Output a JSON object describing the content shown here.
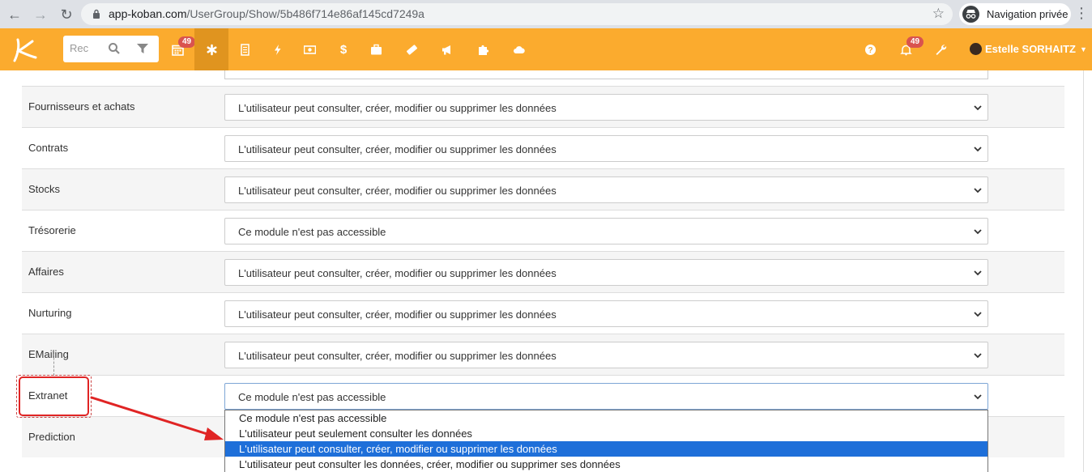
{
  "browser": {
    "url_host": "app-koban.com",
    "url_path": "/UserGroup/Show/5b486f714e86af145cd7249a",
    "incognito_label": "Navigation privée"
  },
  "header": {
    "search_placeholder": "Rec",
    "calendar_badge": "49",
    "notification_badge": "49",
    "user_name": "Estelle SORHAITZ",
    "accent_color": "#fbab2e",
    "active_color": "#e0941f",
    "badge_color": "#d9534f",
    "icons": [
      "calendar-icon",
      "asterisk-icon",
      "document-icon",
      "bolt-icon",
      "money-icon",
      "dollar-icon",
      "briefcase-icon",
      "ticket-icon",
      "megaphone-icon",
      "puzzle-icon",
      "cloud-icon",
      "help-icon",
      "bell-icon",
      "wrench-icon"
    ]
  },
  "rows": [
    {
      "label": "Fournisseurs et achats",
      "value": "L'utilisateur peut consulter, créer, modifier ou supprimer les données"
    },
    {
      "label": "Contrats",
      "value": "L'utilisateur peut consulter, créer, modifier ou supprimer les données"
    },
    {
      "label": "Stocks",
      "value": "L'utilisateur peut consulter, créer, modifier ou supprimer les données"
    },
    {
      "label": "Trésorerie",
      "value": "Ce module n'est pas accessible"
    },
    {
      "label": "Affaires",
      "value": "L'utilisateur peut consulter, créer, modifier ou supprimer les données"
    },
    {
      "label": "Nurturing",
      "value": "L'utilisateur peut consulter, créer, modifier ou supprimer les données"
    },
    {
      "label": "EMailing",
      "value": "L'utilisateur peut consulter, créer, modifier ou supprimer les données"
    },
    {
      "label": "Extranet",
      "value": "Ce module n'est pas accessible"
    },
    {
      "label": "Prediction",
      "value": ""
    }
  ],
  "dropdown": {
    "options": [
      "Ce module n'est pas accessible",
      "L'utilisateur peut seulement consulter les données",
      "L'utilisateur peut consulter, créer, modifier ou supprimer les données",
      "L'utilisateur peut consulter les données, créer, modifier ou supprimer ses données"
    ],
    "highlighted_index": 2,
    "highlight_color": "#1e6fd9"
  },
  "annotation": {
    "color": "#e02424"
  }
}
